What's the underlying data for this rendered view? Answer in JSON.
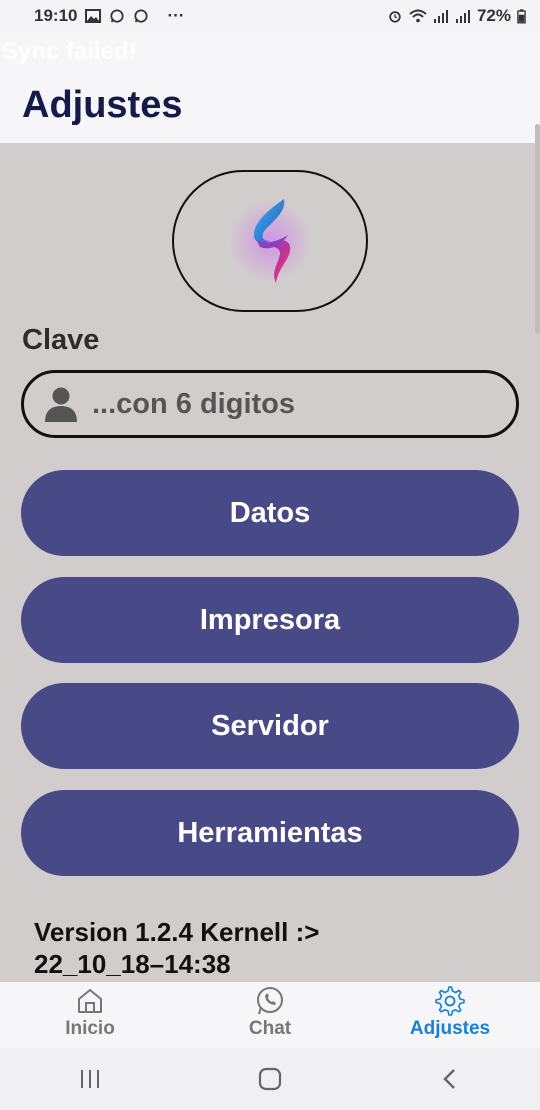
{
  "status_bar": {
    "time": "19:10",
    "more": "···",
    "battery": "72%"
  },
  "sync_banner": "Sync failed!",
  "header": {
    "title": "Adjustes"
  },
  "clave": {
    "label": "Clave",
    "placeholder": "...con 6 digitos",
    "value": ""
  },
  "buttons": {
    "datos": "Datos",
    "impresora": "Impresora",
    "servidor": "Servidor",
    "herramientas": "Herramientas"
  },
  "version": {
    "line1": "Version 1.2.4 Kernell :>",
    "line2": "22_10_18–14:38"
  },
  "bottom_nav": {
    "items": [
      {
        "label": "Inicio",
        "icon": "home-icon"
      },
      {
        "label": "Chat",
        "icon": "whatsapp-icon"
      },
      {
        "label": "Adjustes",
        "icon": "gear-icon",
        "active": true
      }
    ]
  },
  "colors": {
    "background": "#d2cdcd",
    "button": "#484a88",
    "active_tab": "#1a7fd6",
    "title": "#141a4a"
  },
  "system_nav": {
    "icons": [
      "recent-apps-icon",
      "home-circle-icon",
      "back-icon"
    ]
  }
}
